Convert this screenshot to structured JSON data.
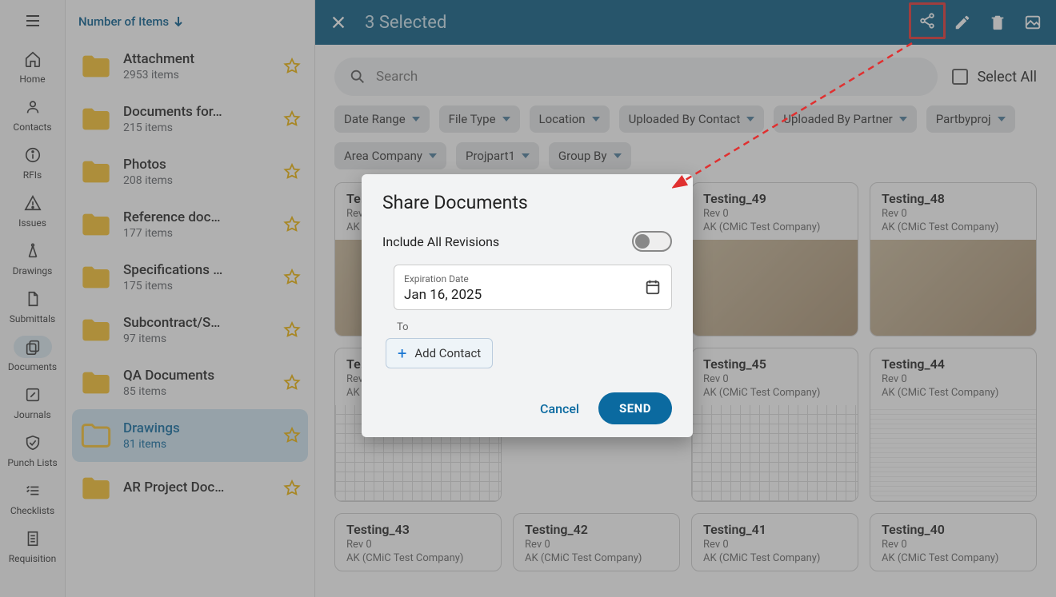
{
  "rail": {
    "items": [
      {
        "label": "Home",
        "icon": "home"
      },
      {
        "label": "Contacts",
        "icon": "person"
      },
      {
        "label": "RFIs",
        "icon": "info"
      },
      {
        "label": "Issues",
        "icon": "warning"
      },
      {
        "label": "Drawings",
        "icon": "compass"
      },
      {
        "label": "Submittals",
        "icon": "file"
      },
      {
        "label": "Documents",
        "icon": "copy",
        "active": true
      },
      {
        "label": "Journals",
        "icon": "pencil-square"
      },
      {
        "label": "Punch Lists",
        "icon": "check-shield"
      },
      {
        "label": "Checklists",
        "icon": "checklist"
      },
      {
        "label": "Requisition",
        "icon": "receipt"
      }
    ]
  },
  "folders": {
    "header": "Number of Items",
    "items": [
      {
        "name": "Attachment",
        "count": "2953 items"
      },
      {
        "name": "Documents for…",
        "count": "215 items"
      },
      {
        "name": "Photos",
        "count": "208 items"
      },
      {
        "name": "Reference doc…",
        "count": "177 items"
      },
      {
        "name": "Specifications …",
        "count": "175 items"
      },
      {
        "name": "Subcontract/S…",
        "count": "97 items"
      },
      {
        "name": "QA Documents",
        "count": "85 items"
      },
      {
        "name": "Drawings",
        "count": "81 items",
        "selected": true
      },
      {
        "name": "AR Project Doc…",
        "count": ""
      }
    ]
  },
  "selection_bar": {
    "title": "3 Selected"
  },
  "search": {
    "placeholder": "Search",
    "select_all": "Select All"
  },
  "filter_chips": [
    "Date Range",
    "File Type",
    "Location",
    "Uploaded By Contact",
    "Uploaded By Partner",
    "Partbyproj",
    "Area Company",
    "Projpart1",
    "Group By"
  ],
  "documents": [
    {
      "title": "Te…",
      "rev": "Rev 0",
      "co": "AK"
    },
    {
      "title": "Testing_49",
      "rev": "Rev 0",
      "co": "AK (CMiC Test Company)"
    },
    {
      "title": "Testing_48",
      "rev": "Rev 0",
      "co": "AK (CMiC Test Company)"
    },
    {
      "title": "Te…",
      "rev": "Rev 0",
      "co": "AK"
    },
    {
      "title": "Testing_45",
      "rev": "Rev 0",
      "co": "AK (CMiC Test Company)"
    },
    {
      "title": "Testing_44",
      "rev": "Rev 0",
      "co": "AK (CMiC Test Company)"
    },
    {
      "title": "Testing_43",
      "rev": "Rev 0",
      "co": "AK (CMiC Test Company)"
    },
    {
      "title": "Testing_42",
      "rev": "Rev 0",
      "co": "AK (CMiC Test Company)"
    },
    {
      "title": "Testing_41",
      "rev": "Rev 0",
      "co": "AK (CMiC Test Company)"
    },
    {
      "title": "Testing_40",
      "rev": "Rev 0",
      "co": "AK (CMiC Test Company)"
    }
  ],
  "modal": {
    "title": "Share Documents",
    "toggle_label": "Include All Revisions",
    "exp_label": "Expiration Date",
    "exp_value": "Jan 16, 2025",
    "to_label": "To",
    "add_contact": "Add Contact",
    "cancel": "Cancel",
    "send": "SEND"
  }
}
